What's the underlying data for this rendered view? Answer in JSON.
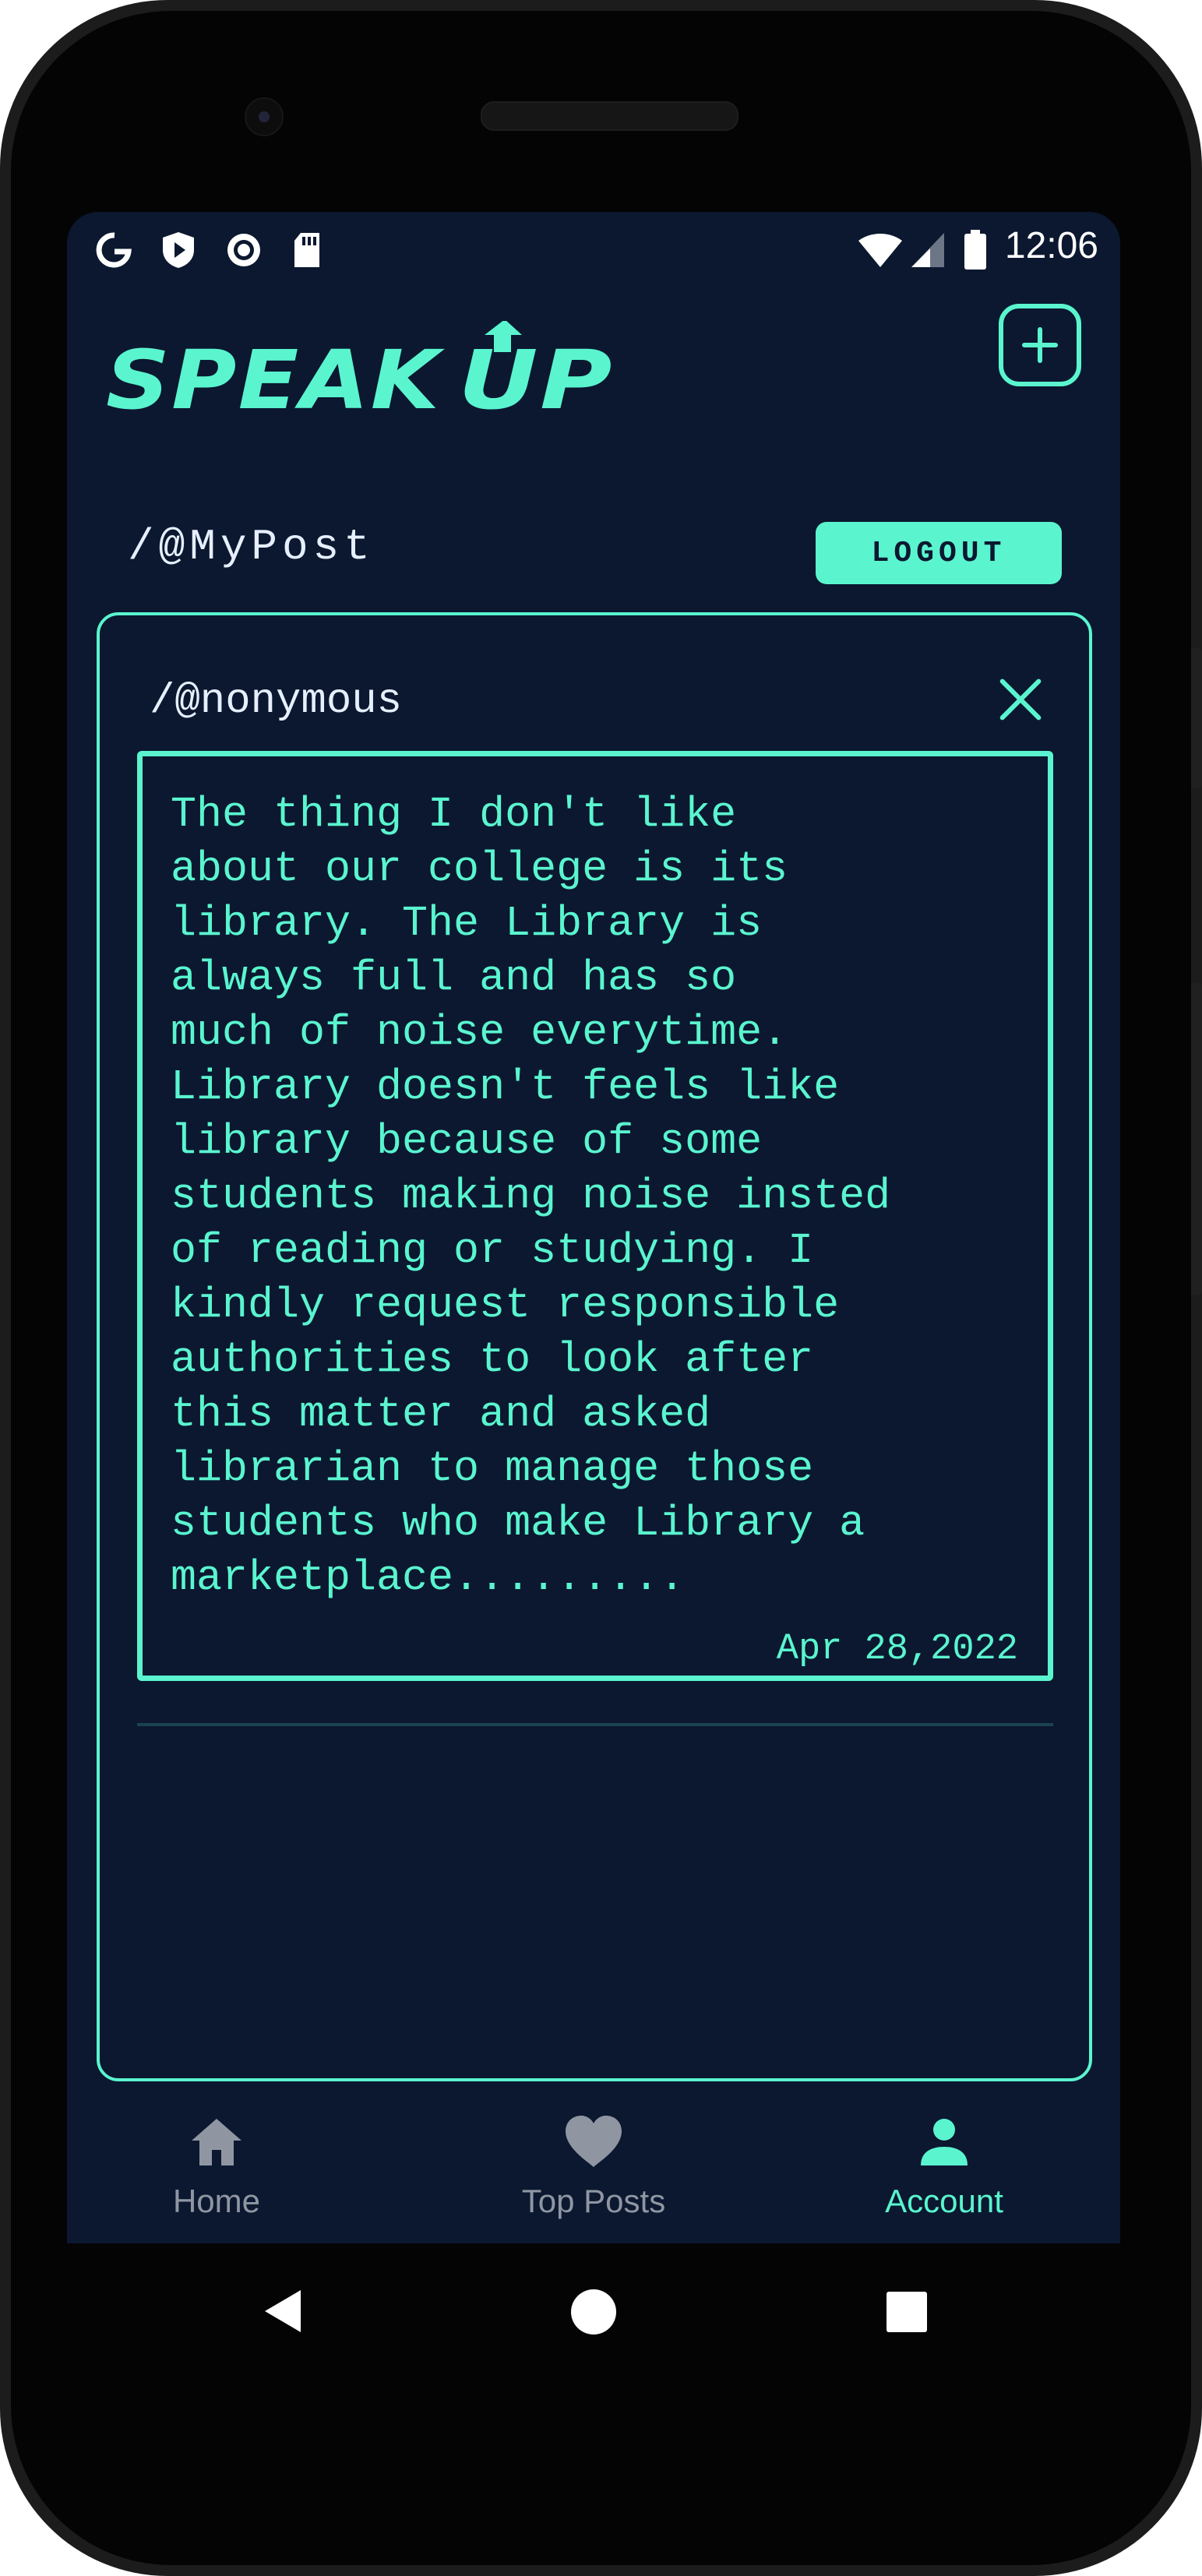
{
  "status_bar": {
    "time": "12:06",
    "left_icons": [
      "google-icon",
      "play-protect-icon",
      "record-icon",
      "sd-card-icon"
    ],
    "right_icons": [
      "wifi-icon",
      "cellular-signal-icon",
      "battery-icon"
    ]
  },
  "app": {
    "logo": "SPEAK UP",
    "add_icon": "plus-square-icon",
    "accent_color": "#5af5cf",
    "background_color": "#0b1830"
  },
  "header": {
    "title": "/@MyPost",
    "logout_label": "LOGOUT"
  },
  "post": {
    "author": "/@nonymous",
    "close_icon": "close-icon",
    "text": "The thing I don't like\nabout our college is its\nlibrary. The Library is\nalways full and has so\nmuch of noise everytime.\nLibrary doesn't feels like\nlibrary because of some\nstudents making noise insted\nof reading or studying. I\nkindly request responsible\nauthorities to look after\nthis matter and asked\nlibrarian to manage those\nstudents who make Library a\nmarketplace.........",
    "date": "Apr 28,2022"
  },
  "bottom_nav": {
    "items": [
      {
        "label": "Home",
        "icon": "home-icon",
        "active": false
      },
      {
        "label": "Top Posts",
        "icon": "heart-icon",
        "active": false
      },
      {
        "label": "Account",
        "icon": "person-icon",
        "active": true
      }
    ],
    "active_color": "#5af5cf",
    "inactive_color": "#8f96a2"
  },
  "system_nav": {
    "icons": [
      "back-icon",
      "home-circle-icon",
      "recents-icon"
    ]
  }
}
